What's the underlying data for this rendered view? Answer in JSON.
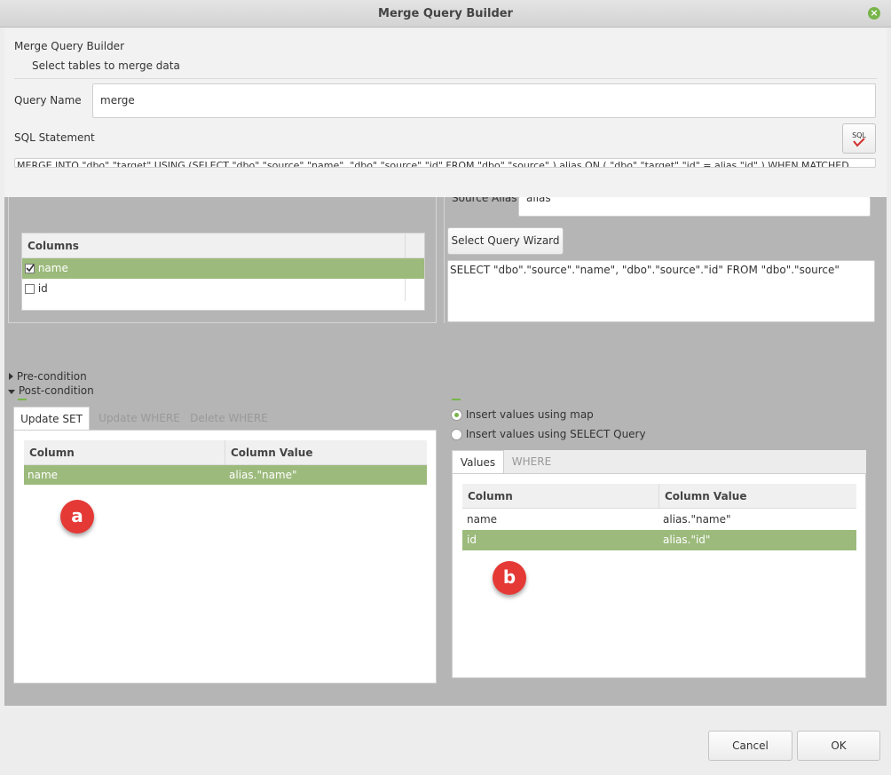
{
  "window": {
    "title": "Merge Query Builder"
  },
  "header": {
    "title": "Merge Query Builder",
    "subtitle": "Select tables to merge data",
    "query_name_label": "Query Name",
    "query_name_value": "merge",
    "sql_statement_label": "SQL Statement",
    "sql_statement_value": "MERGE INTO \"dbo\".\"target\" USING (SELECT \"dbo\".\"source\".\"name\", \"dbo\".\"source\".\"id\" FROM \"dbo\".\"source\" ) alias ON ( \"dbo\".\"target\".\"id\" = alias.\"id\" ) WHEN MATCHED",
    "sql_button_icon": "sql-check-icon",
    "sql_button_text": "SQL"
  },
  "source": {
    "columns_header": "Columns",
    "columns": [
      {
        "name": "name",
        "checked": true
      },
      {
        "name": "id",
        "checked": false
      }
    ],
    "alias_label": "Source Alias",
    "alias_value": "alias",
    "wizard_button": "Select Query Wizard",
    "select_query": "SELECT \"dbo\".\"source\".\"name\", \"dbo\".\"source\".\"id\" FROM \"dbo\".\"source\""
  },
  "conditions": {
    "pre": "Pre-condition",
    "post": "Post-condition"
  },
  "update_panel": {
    "tabs": [
      "Update SET",
      "Update WHERE",
      "Delete WHERE"
    ],
    "headers": [
      "Column",
      "Column Value"
    ],
    "rows": [
      {
        "column": "name",
        "value": "alias.\"name\""
      }
    ],
    "badge": "a"
  },
  "insert_panel": {
    "option_map": "Insert values using map",
    "option_select": "Insert values using SELECT Query",
    "tabs": [
      "Values",
      "WHERE"
    ],
    "headers": [
      "Column",
      "Column Value"
    ],
    "rows": [
      {
        "column": "name",
        "value": "alias.\"name\""
      },
      {
        "column": "id",
        "value": "alias.\"id\""
      }
    ],
    "badge": "b"
  },
  "footer": {
    "cancel": "Cancel",
    "ok": "OK"
  },
  "colors": {
    "selection": "#9cba7c",
    "accent": "#78b54a",
    "badge": "#e53935"
  }
}
